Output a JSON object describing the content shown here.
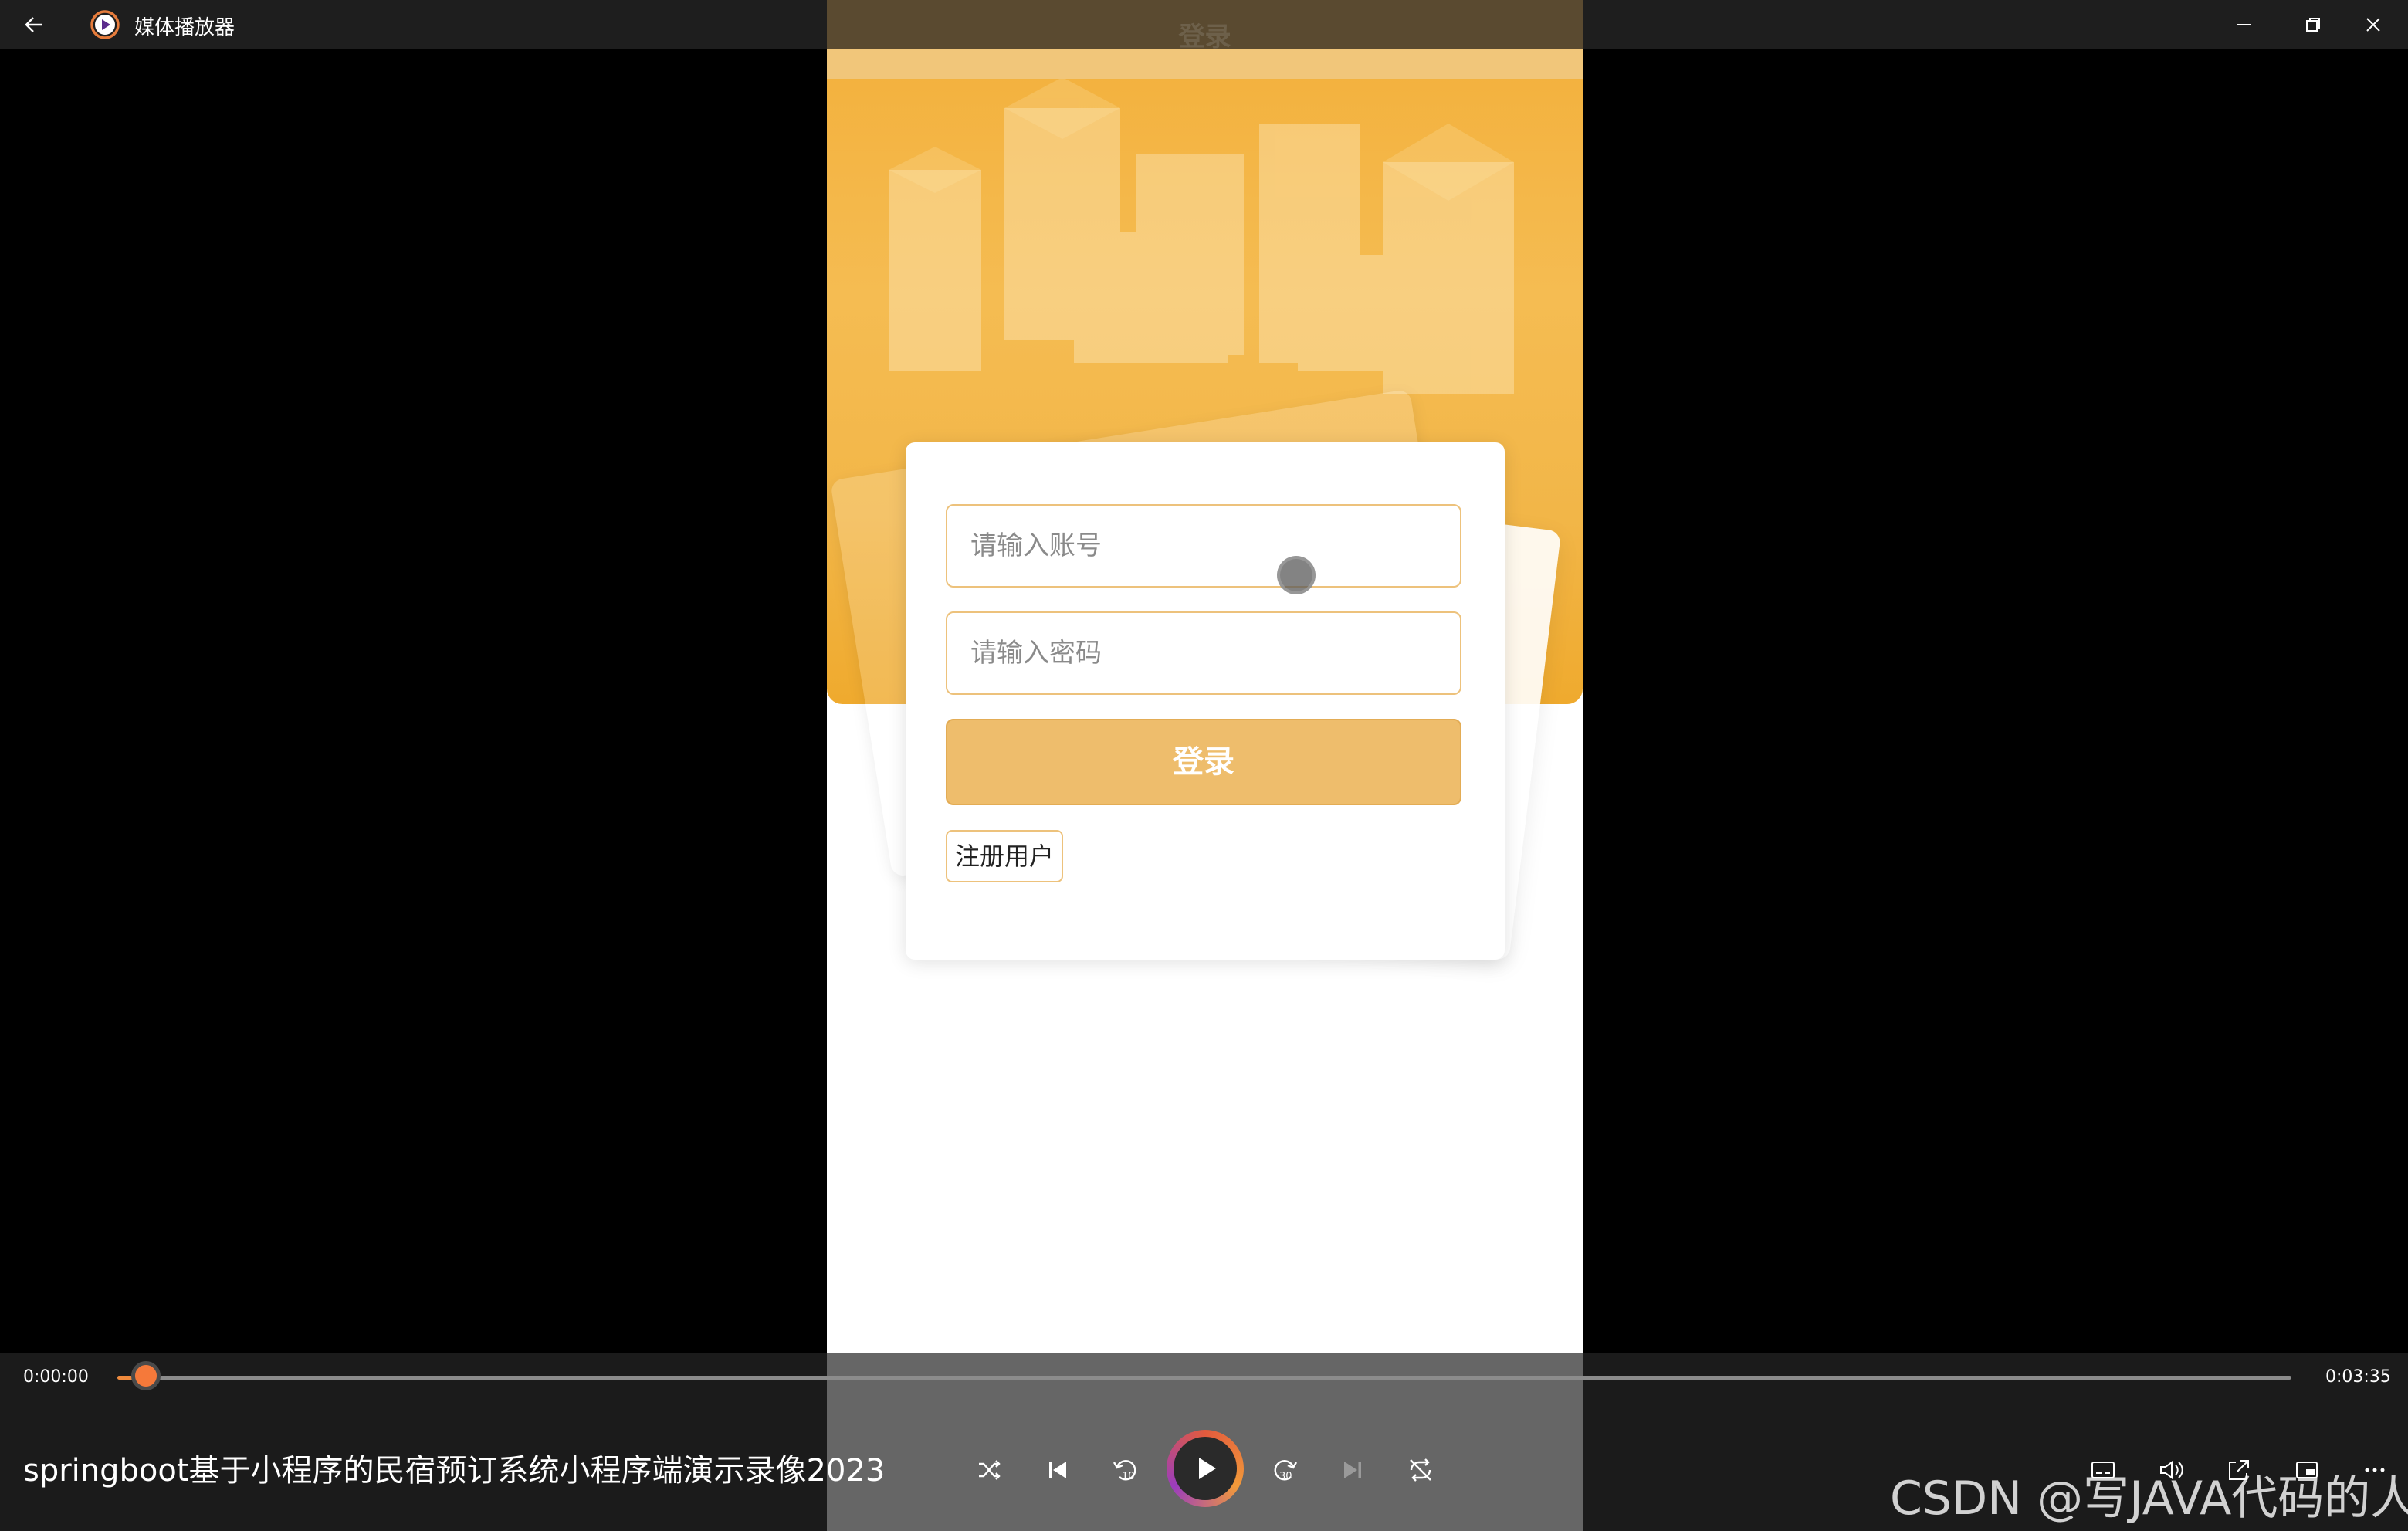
{
  "window": {
    "title": "媒体播放器",
    "icons": [
      "back-arrow-icon",
      "media-player-logo",
      "minimize-icon",
      "restore-icon",
      "close-icon"
    ]
  },
  "app": {
    "nav_title": "登录",
    "username_placeholder": "请输入账号",
    "password_placeholder": "请输入密码",
    "login_label": "登录",
    "register_label": "注册用户"
  },
  "player": {
    "current_time": "0:00:00",
    "total_time": "0:03:35",
    "progress_fraction": 0.005,
    "video_title": "springboot基于小程序的民宿预订系统小程序端演示录像2023",
    "rewind_seconds": "10",
    "forward_seconds": "30",
    "watermark": "CSDN @写JAVA代码的人",
    "accent_color": "#f5793a"
  }
}
